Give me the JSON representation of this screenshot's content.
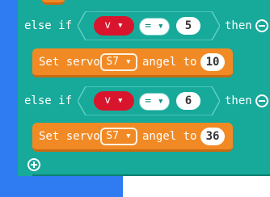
{
  "blocks": {
    "else_if_1": {
      "keyword": "else if",
      "variable": "v ▾",
      "operator": "= ▾",
      "value": "5",
      "then": "then",
      "statement": {
        "prefix": "Set servo",
        "servo": "S7 ▾",
        "middle": "angel to",
        "angle": "10"
      }
    },
    "else_if_2": {
      "keyword": "else if",
      "variable": "v ▾",
      "operator": "= ▾",
      "value": "6",
      "then": "then",
      "statement": {
        "prefix": "Set servo",
        "servo": "S7 ▾",
        "middle": "angel to",
        "angle": "36"
      }
    }
  },
  "icons": {
    "remove": "minus-circle-icon",
    "add": "plus-circle-icon"
  },
  "colors": {
    "logic_block": "#17a99a",
    "servo_block": "#f18a25",
    "variable_pill": "#d9152d",
    "workspace_side": "#2f7bf2"
  }
}
